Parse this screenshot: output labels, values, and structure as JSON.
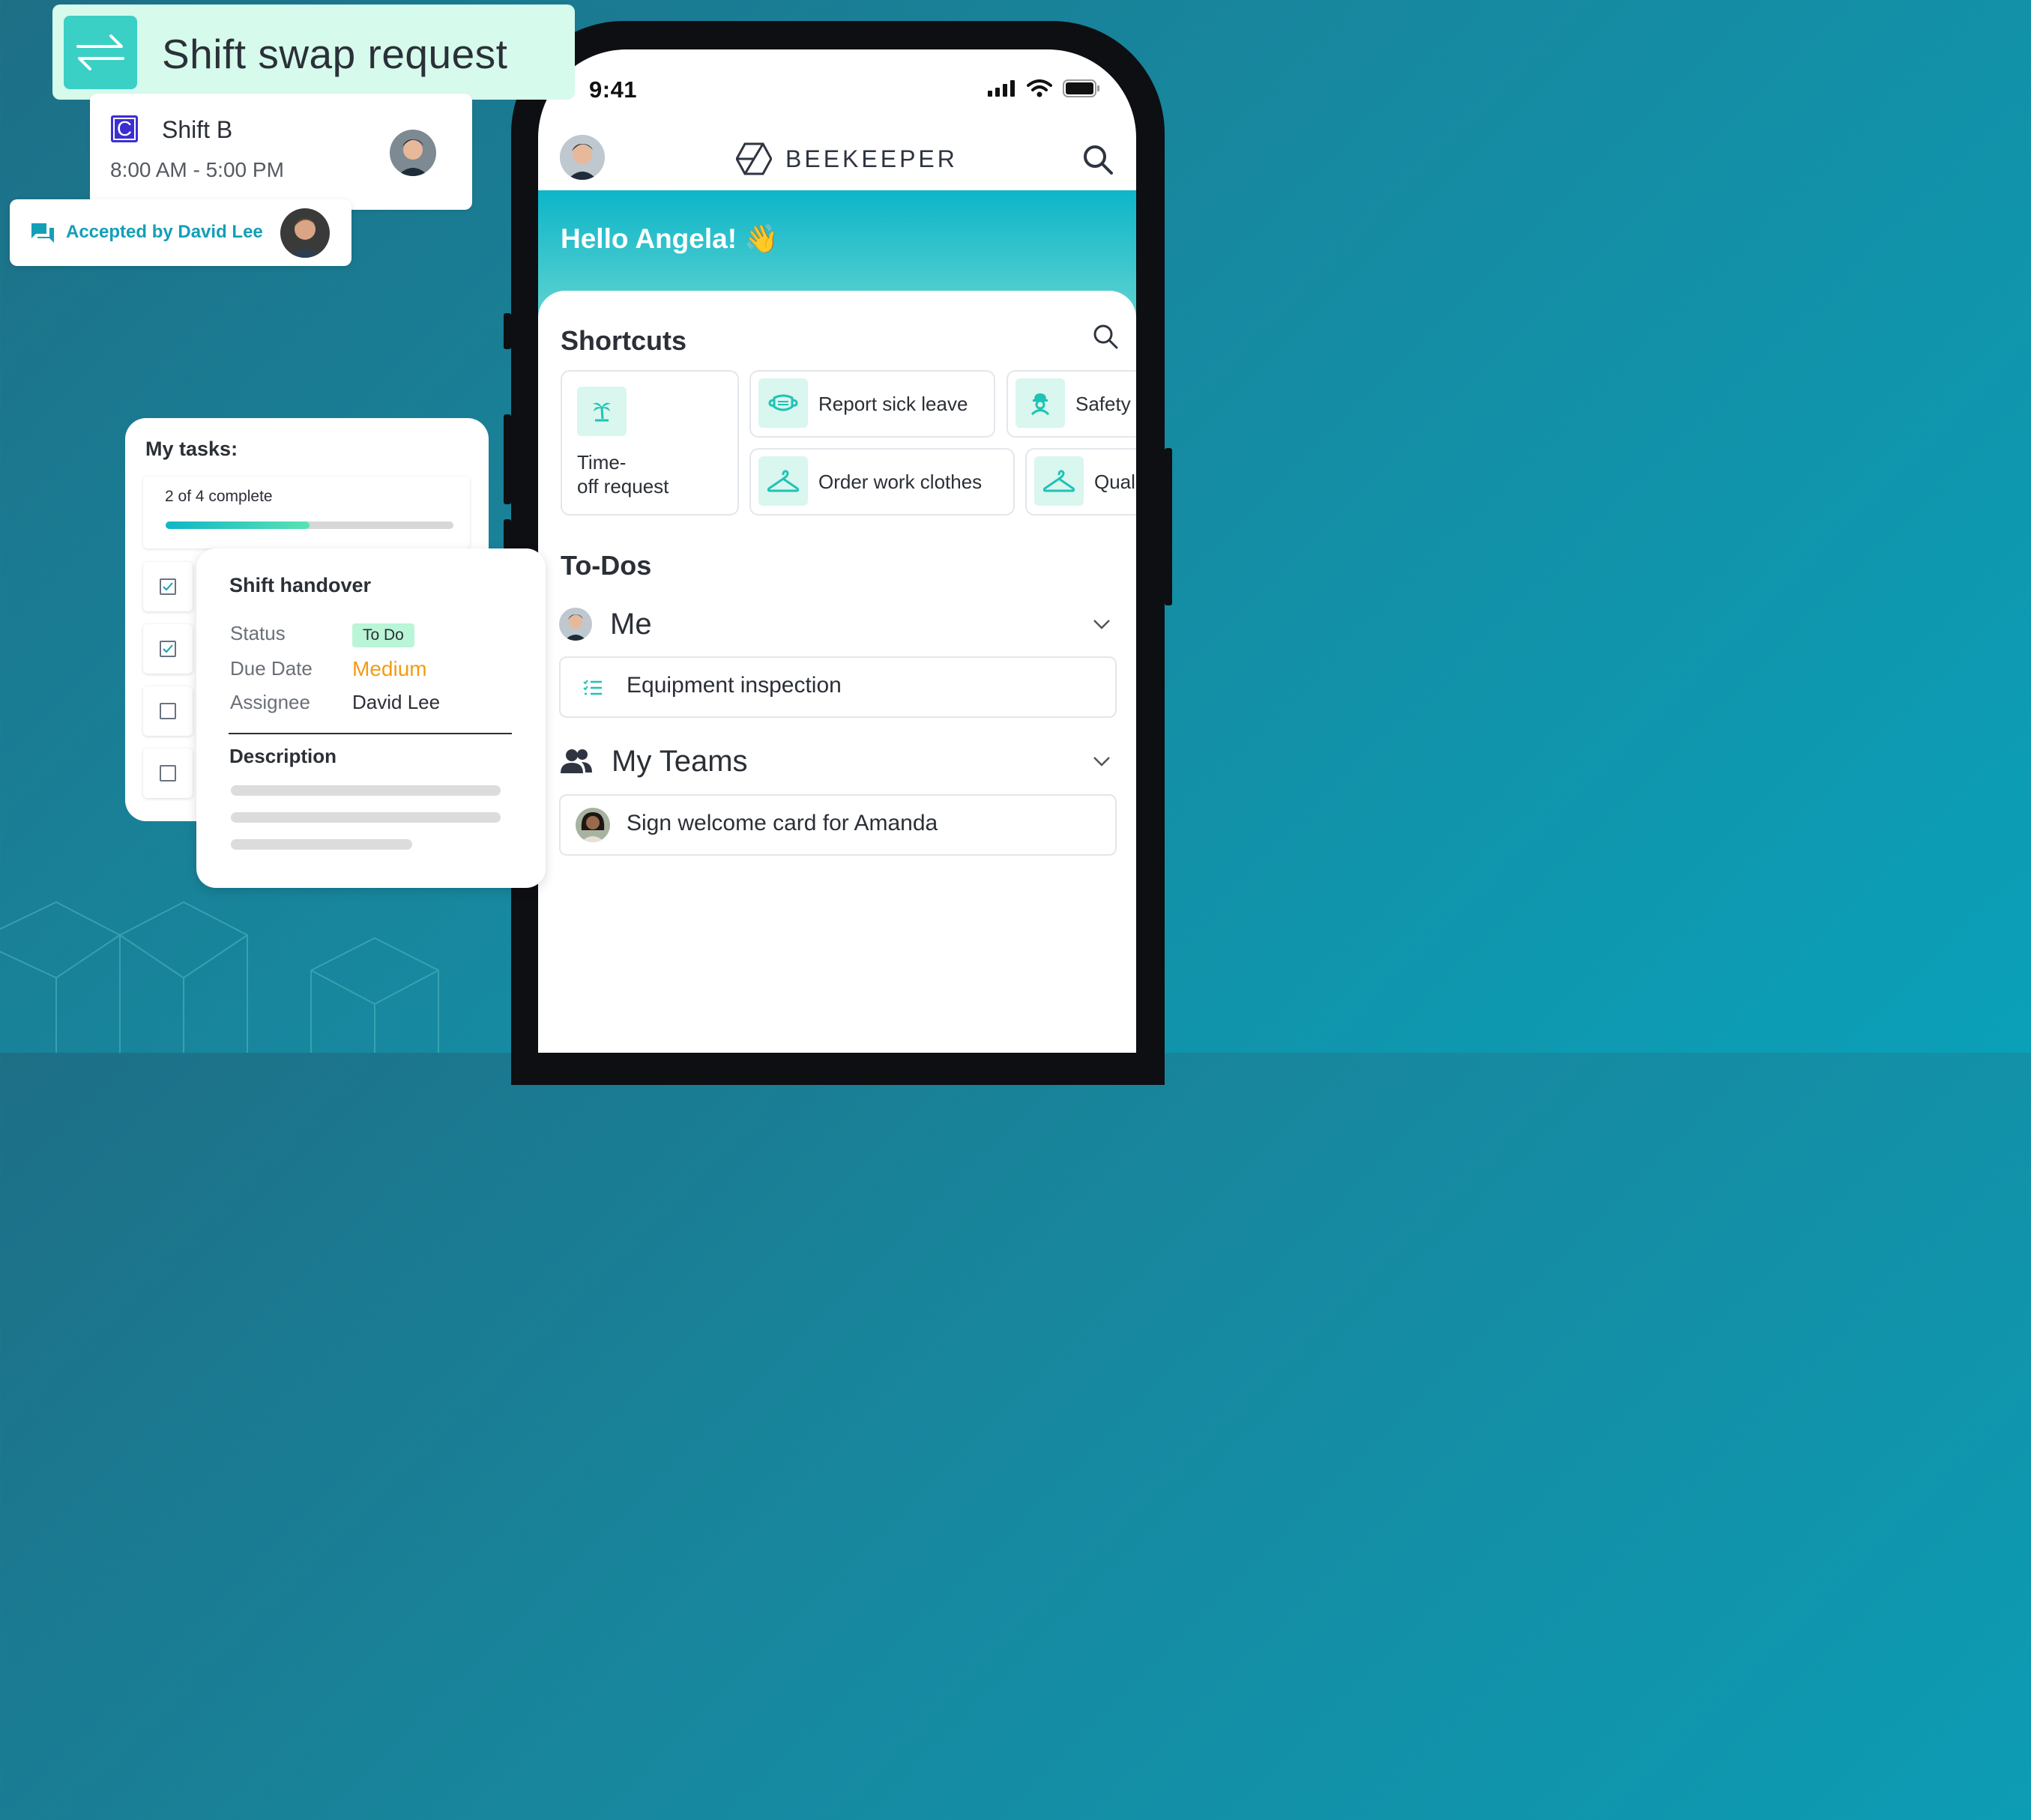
{
  "swap_card": {
    "title": "Shift swap request"
  },
  "shift_card": {
    "app_letter": "C",
    "shift_name": "Shift B",
    "shift_time": "8:00 AM - 5:00 PM"
  },
  "accepted_card": {
    "text": "Accepted by David Lee"
  },
  "tasks_card": {
    "title": "My tasks:",
    "progress_text": "2 of 4 complete",
    "progress_fraction": 0.5,
    "checkboxes": [
      true,
      true,
      false,
      false
    ]
  },
  "handover_card": {
    "title": "Shift handover",
    "status_label": "Status",
    "status_value": "To Do",
    "due_label": "Due Date",
    "due_value": "Medium",
    "assignee_label": "Assignee",
    "assignee_value": "David Lee",
    "description_label": "Description"
  },
  "phone": {
    "time": "9:41",
    "brand": "BEEKEEPER",
    "greeting": "Hello Angela! 👋",
    "shortcuts_title": "Shortcuts",
    "shortcuts": [
      {
        "label": "Time-",
        "label2": "off request",
        "icon": "palm-tree-icon"
      },
      {
        "label": "Report sick leave",
        "icon": "face-mask-icon"
      },
      {
        "label": "Safety",
        "icon": "worker-icon"
      },
      {
        "label": "Order work clothes",
        "icon": "hanger-icon"
      },
      {
        "label": "Qual",
        "icon": "hanger-icon"
      }
    ],
    "todos_title": "To-Dos",
    "me_label": "Me",
    "me_item": "Equipment inspection",
    "teams_label": "My Teams",
    "teams_item": "Sign welcome card for Amanda"
  },
  "colors": {
    "accent": "#0db5c9",
    "mint": "#d6faec",
    "orange": "#f39c12",
    "link": "#139fb8"
  }
}
